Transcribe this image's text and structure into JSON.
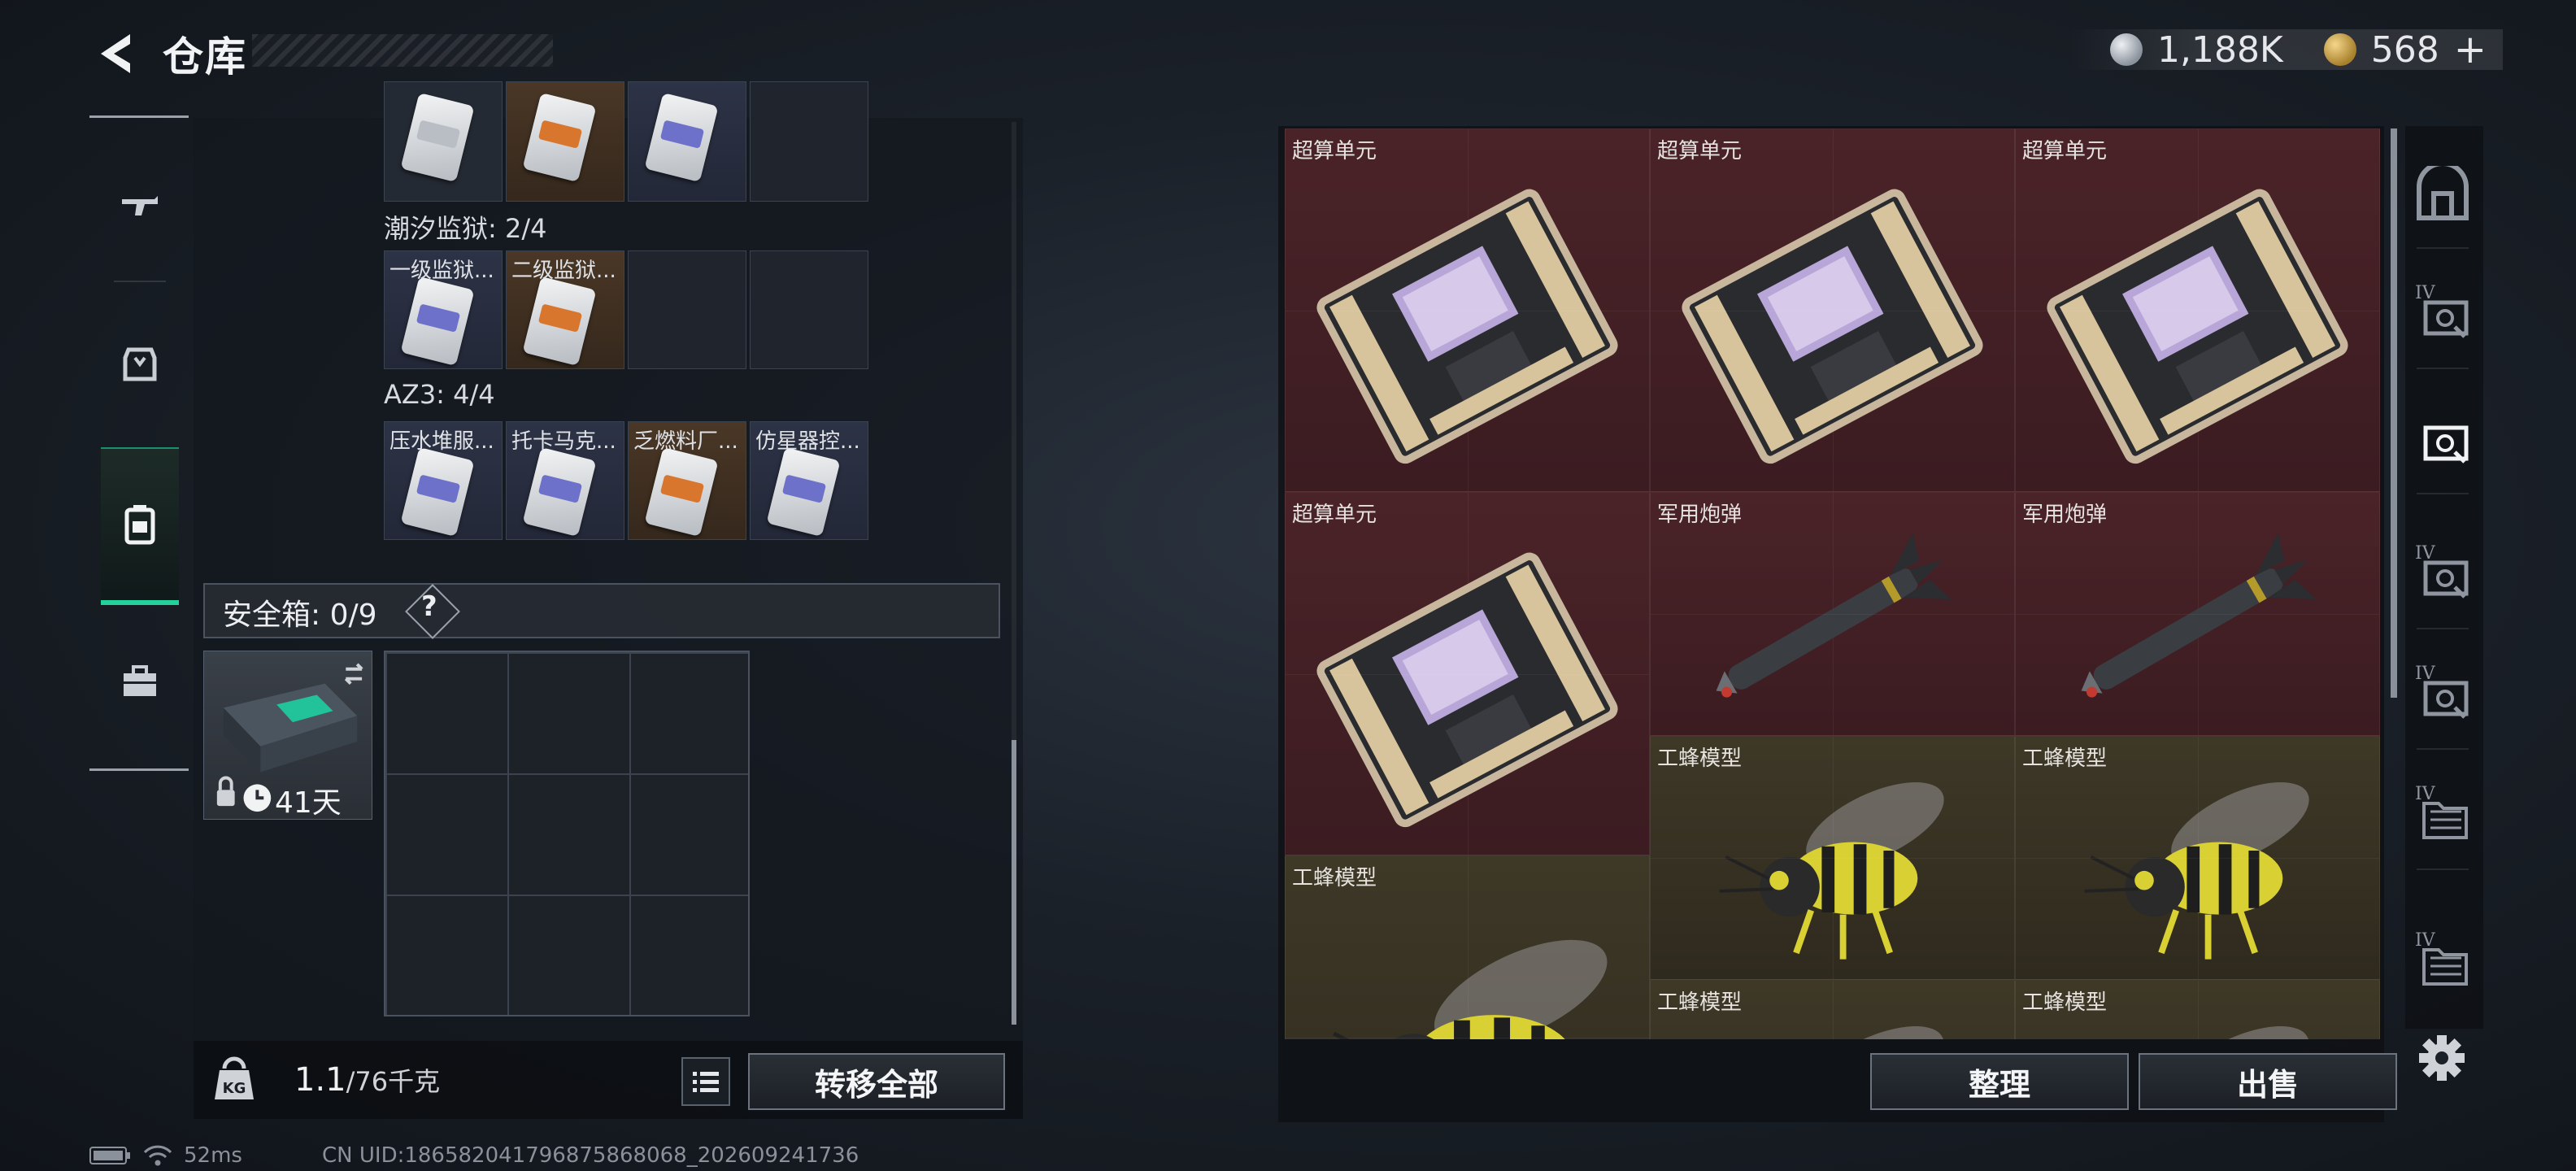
{
  "header": {
    "title": "仓库",
    "currency_silver": "1,188K",
    "currency_gold": "568",
    "add_label": "+"
  },
  "left_nav": {
    "items": [
      "weapon-icon",
      "armor-icon",
      "backpack-icon",
      "toolbox-icon"
    ],
    "active_index": 2
  },
  "container_sections": [
    {
      "label": "",
      "items": [
        {
          "name": "",
          "rarity": "white"
        },
        {
          "name": "",
          "rarity": "orange"
        },
        {
          "name": "",
          "rarity": "blue"
        },
        {
          "name": "",
          "rarity": "empty"
        }
      ]
    },
    {
      "label": "潮汐监狱: 2/4",
      "items": [
        {
          "name": "一级监狱...",
          "rarity": "blue"
        },
        {
          "name": "二级监狱...",
          "rarity": "orange"
        },
        {
          "name": "",
          "rarity": "empty"
        },
        {
          "name": "",
          "rarity": "empty"
        }
      ]
    },
    {
      "label": "AZ3: 4/4",
      "items": [
        {
          "name": "压水堆服...",
          "rarity": "blue"
        },
        {
          "name": "托卡马克...",
          "rarity": "blue"
        },
        {
          "name": "乏燃料厂...",
          "rarity": "orange"
        },
        {
          "name": "仿星器控...",
          "rarity": "blue"
        }
      ]
    }
  ],
  "safe_box": {
    "label": "安全箱: 0/9",
    "help": "?",
    "days_left": "41天"
  },
  "bottom_left": {
    "weight_current": "1.1",
    "weight_max": "/76千克",
    "transfer_all_label": "转移全部"
  },
  "right_items": [
    {
      "name": "超算单元",
      "type": "chip",
      "rarity": "red"
    },
    {
      "name": "超算单元",
      "type": "chip",
      "rarity": "red"
    },
    {
      "name": "超算单元",
      "type": "chip",
      "rarity": "red"
    },
    {
      "name": "超算单元",
      "type": "chip",
      "rarity": "red"
    },
    {
      "name": "军用炮弹",
      "type": "missile",
      "rarity": "red"
    },
    {
      "name": "军用炮弹",
      "type": "missile",
      "rarity": "red"
    },
    {
      "name": "工蜂模型",
      "type": "bee",
      "rarity": "olive"
    },
    {
      "name": "工蜂模型",
      "type": "bee",
      "rarity": "olive"
    },
    {
      "name": "工蜂模型",
      "type": "bee",
      "rarity": "olive"
    },
    {
      "name": "工蜂模型",
      "type": "bee",
      "rarity": "olive"
    },
    {
      "name": "工蜂模型",
      "type": "bee",
      "rarity": "olive"
    }
  ],
  "right_sidebar": [
    "safe-icon",
    "tier4-crate-icon",
    "crate-icon",
    "tier4-crate-icon",
    "tier4-crate-icon",
    "tier4-folder-icon",
    "tier4-folder-icon"
  ],
  "right_sidebar_label": "IV",
  "bottom_right": {
    "sort_label": "整理",
    "sell_label": "出售"
  },
  "status": {
    "ping": "52ms",
    "uid": "CN UID:18658204179687586806​8_202609241736"
  },
  "colors": {
    "accent": "#25d19a",
    "rarity_red": "#4a2328",
    "rarity_olive": "#3e3827",
    "rarity_orange": "#4a3726",
    "rarity_blue": "#2d3346"
  }
}
